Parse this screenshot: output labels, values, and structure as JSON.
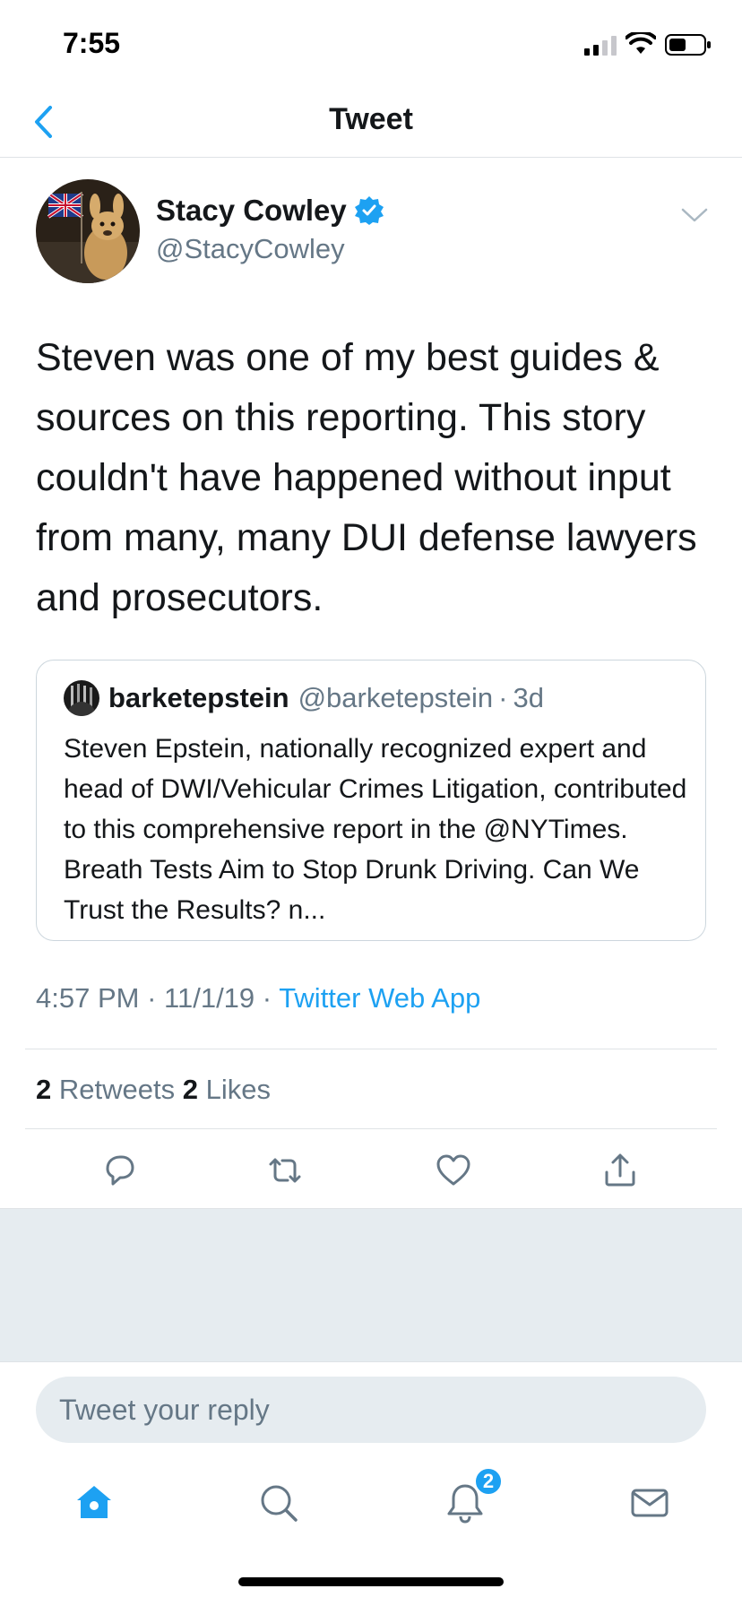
{
  "status_bar": {
    "time": "7:55"
  },
  "nav": {
    "title": "Tweet"
  },
  "tweet": {
    "author_name": "Stacy Cowley",
    "author_handle": "@StacyCowley",
    "text": "Steven was one of my best guides & sources on this reporting. This story couldn't have happened without input from many, many DUI defense lawyers and prosecutors.",
    "time": "4:57 PM",
    "date": "11/1/19",
    "separator": "·",
    "source_app": "Twitter Web App"
  },
  "quote": {
    "name": "barketepstein",
    "handle": "@barketepstein",
    "separator": "·",
    "time": "3d",
    "text": "Steven Epstein, nationally recognized expert and head of DWI/Vehicular Crimes Litigation, contributed to this comprehensive report in the @NYTimes. Breath Tests Aim to Stop Drunk Driving. Can We Trust the Results? n..."
  },
  "stats": {
    "retweets_count": "2",
    "retweets_label": "Retweets",
    "likes_count": "2",
    "likes_label": "Likes"
  },
  "reply": {
    "placeholder": "Tweet your reply"
  },
  "tab_bar": {
    "notifications_badge": "2"
  },
  "colors": {
    "accent": "#1da1f2",
    "secondary_text": "#657786",
    "divider": "#dfe3e6",
    "background_gray": "#e6ecf0"
  },
  "icons": [
    "back-chevron-icon",
    "verified-badge-icon",
    "chevron-down-icon",
    "reply-icon",
    "retweet-icon",
    "like-icon",
    "share-icon",
    "home-icon",
    "search-icon",
    "notifications-icon",
    "messages-icon"
  ]
}
